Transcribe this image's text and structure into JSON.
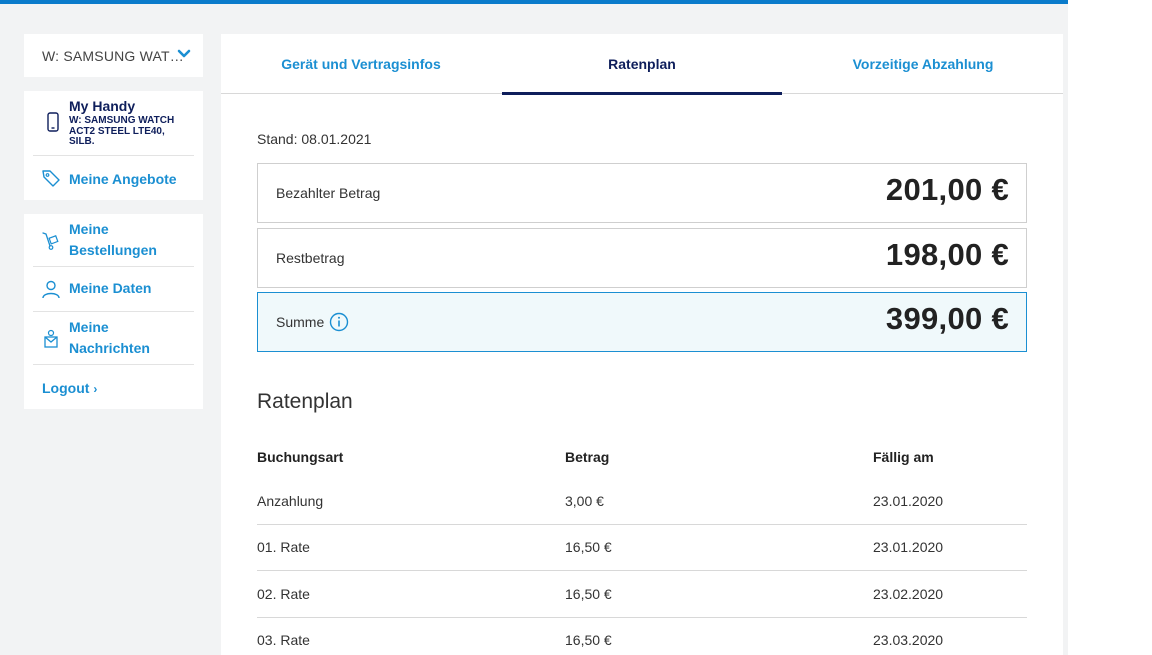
{
  "sidebar": {
    "device_select": "W: SAMSUNG WAT…",
    "my_handy_title": "My Handy",
    "my_handy_device": "W: SAMSUNG WATCH ACT2 STEEL LTE40, SILB.",
    "angebote": "Meine Angebote",
    "bestellungen": "Meine Bestellungen",
    "daten": "Meine Daten",
    "nachrichten": "Meine Nachrichten",
    "logout": "Logout"
  },
  "tabs": [
    {
      "label": "Gerät und Vertragsinfos"
    },
    {
      "label": "Ratenplan"
    },
    {
      "label": "Vorzeitige Abzahlung"
    }
  ],
  "stand": "Stand: 08.01.2021",
  "summary": {
    "paid_label": "Bezahlter Betrag",
    "paid_value": "201,00 €",
    "rest_label": "Restbetrag",
    "rest_value": "198,00 €",
    "sum_label": "Summe",
    "sum_value": "399,00 €"
  },
  "ratenplan": {
    "title": "Ratenplan",
    "headers": [
      "Buchungsart",
      "Betrag",
      "Fällig am"
    ],
    "rows": [
      [
        "Anzahlung",
        "3,00 €",
        "23.01.2020"
      ],
      [
        "01. Rate",
        "16,50 €",
        "23.01.2020"
      ],
      [
        "02. Rate",
        "16,50 €",
        "23.02.2020"
      ],
      [
        "03. Rate",
        "16,50 €",
        "23.03.2020"
      ]
    ]
  },
  "colors": {
    "accent": "#1b8fd2",
    "navy": "#0e1e5b",
    "top_bar": "#0a7bcb"
  }
}
